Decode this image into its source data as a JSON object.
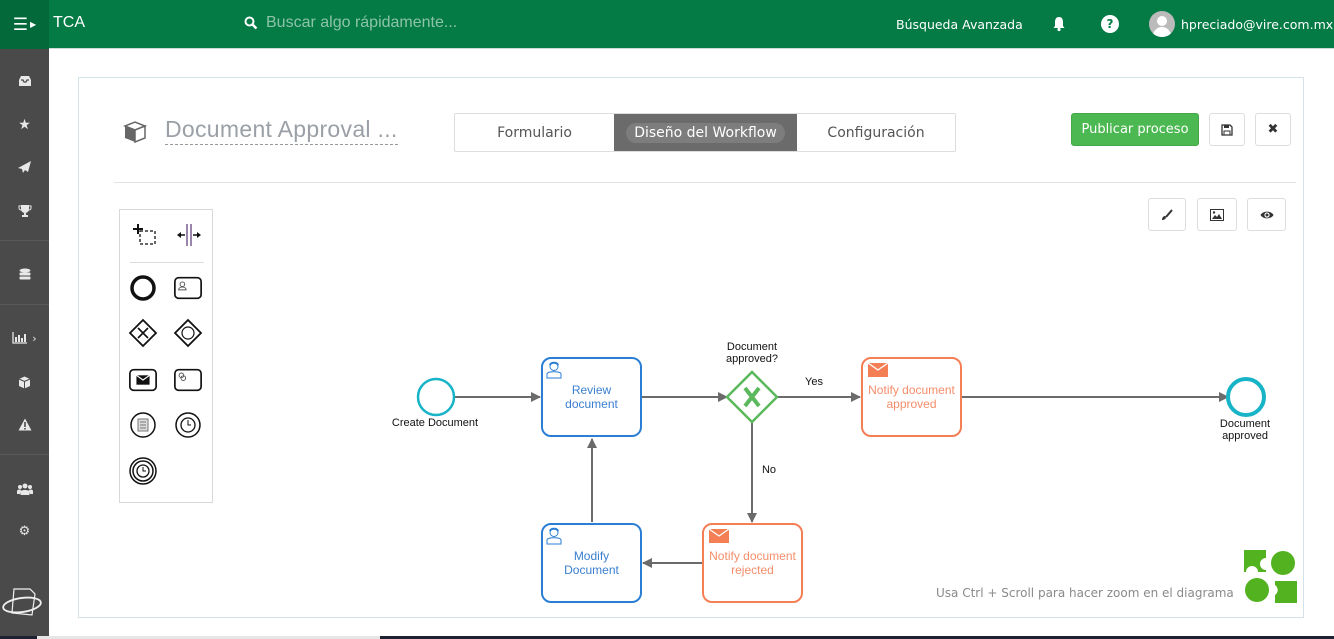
{
  "header": {
    "brand": "TCA",
    "search_placeholder": "Buscar algo rápidamente...",
    "advanced_search": "Búsqueda Avanzada",
    "user_email": "hpreciado@vire.com.mx",
    "icons": [
      "menu-icon",
      "search-icon",
      "bell-icon",
      "help-icon",
      "avatar"
    ]
  },
  "sidebar": {
    "items": [
      {
        "name": "inbox",
        "icon": "inbox-icon"
      },
      {
        "name": "favorites",
        "icon": "star-icon"
      },
      {
        "name": "sent",
        "icon": "paper-plane-icon"
      },
      {
        "name": "achievements",
        "icon": "trophy-icon"
      },
      {
        "name": "database",
        "icon": "database-icon"
      },
      {
        "name": "reports",
        "icon": "bar-chart-icon",
        "has_submenu": true
      },
      {
        "name": "processes",
        "icon": "cube-icon"
      },
      {
        "name": "alerts",
        "icon": "warning-icon"
      },
      {
        "name": "users",
        "icon": "users-icon"
      },
      {
        "name": "settings",
        "icon": "gear-icon"
      }
    ]
  },
  "process": {
    "title": "Document Approval ...",
    "tabs": [
      {
        "label": "Formulario",
        "active": false
      },
      {
        "label": "Diseño del Workflow",
        "active": true
      },
      {
        "label": "Configuración",
        "active": false
      }
    ],
    "publish_label": "Publicar proceso",
    "actions": [
      "save-icon",
      "close-icon"
    ],
    "canvas_tools": [
      "brush-icon",
      "image-icon",
      "eye-icon"
    ]
  },
  "palette": {
    "tools": [
      "lasso-tool",
      "space-tool"
    ],
    "shapes": [
      "end-event",
      "user-task",
      "exclusive-gateway",
      "event-based-gateway",
      "send-task",
      "service-task",
      "conditional-event",
      "timer-event",
      "timer-boundary-event"
    ]
  },
  "diagram": {
    "start_event": {
      "label": "Create Document"
    },
    "tasks": {
      "review": {
        "label1": "Review",
        "label2": "document",
        "type": "user"
      },
      "modify": {
        "label1": "Modify",
        "label2": "Document",
        "type": "user"
      },
      "notify_approved": {
        "label1": "Notify document",
        "label2": "approved",
        "type": "send"
      },
      "notify_rejected": {
        "label1": "Notify document",
        "label2": "rejected",
        "type": "send"
      }
    },
    "gateway": {
      "label1": "Document",
      "label2": "approved?"
    },
    "flows": {
      "yes": "Yes",
      "no": "No"
    },
    "end_event": {
      "label1": "Document",
      "label2": "approved"
    },
    "colors": {
      "user_task": "#2a7fd4",
      "send_task": "#f47f55",
      "event": "#17b3c6",
      "gateway": "#5cb85c",
      "flow": "#6b6b6b"
    }
  },
  "footer": {
    "zoom_hint": "Usa Ctrl + Scroll para hacer zoom en el diagrama"
  }
}
